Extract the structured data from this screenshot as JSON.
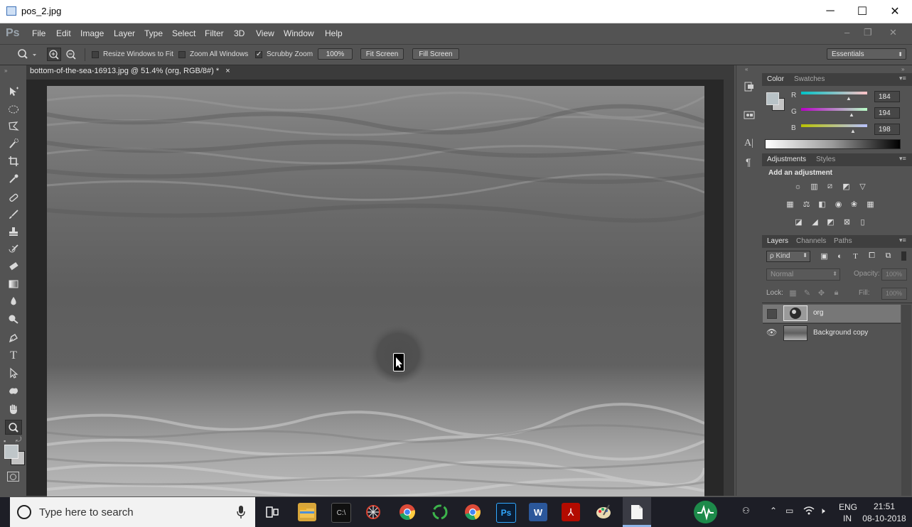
{
  "window": {
    "title": "pos_2.jpg",
    "minimize": "─",
    "maximize": "☐",
    "close": "✕"
  },
  "ps": {
    "logo": "Ps",
    "menu": [
      "File",
      "Edit",
      "Image",
      "Layer",
      "Type",
      "Select",
      "Filter",
      "3D",
      "View",
      "Window",
      "Help"
    ],
    "win_controls": [
      "–",
      "❐",
      "✕"
    ]
  },
  "options": {
    "resize_windows_label": "Resize Windows to Fit",
    "zoom_all_label": "Zoom All Windows",
    "scrubby_label": "Scrubby Zoom",
    "zoom_value": "100%",
    "fit_screen": "Fit Screen",
    "fill_screen": "Fill Screen",
    "workspace": "Essentials"
  },
  "document": {
    "tab_title": "bottom-of-the-sea-16913.jpg @ 51.4% (org, RGB/8#) *",
    "tab_close": "×"
  },
  "color_panel": {
    "tabs": [
      "Color",
      "Swatches"
    ],
    "r_label": "R",
    "r_value": "184",
    "g_label": "G",
    "g_value": "194",
    "b_label": "B",
    "b_value": "198"
  },
  "adjustments_panel": {
    "tabs": [
      "Adjustments",
      "Styles"
    ],
    "heading": "Add an adjustment"
  },
  "layers_panel": {
    "tabs": [
      "Layers",
      "Channels",
      "Paths"
    ],
    "kind_label": "ρ Kind",
    "blend_mode": "Normal",
    "opacity_label": "Opacity:",
    "opacity_value": "100%",
    "lock_label": "Lock:",
    "fill_label": "Fill:",
    "fill_value": "100%",
    "layers": [
      {
        "name": "org",
        "selected": true,
        "visible": false
      },
      {
        "name": "Background copy",
        "selected": false,
        "visible": true
      }
    ]
  },
  "taskbar": {
    "search_placeholder": "Type here to search",
    "lang_line1": "ENG",
    "lang_line2": "IN",
    "time": "21:51",
    "date": "08-10-2018"
  }
}
